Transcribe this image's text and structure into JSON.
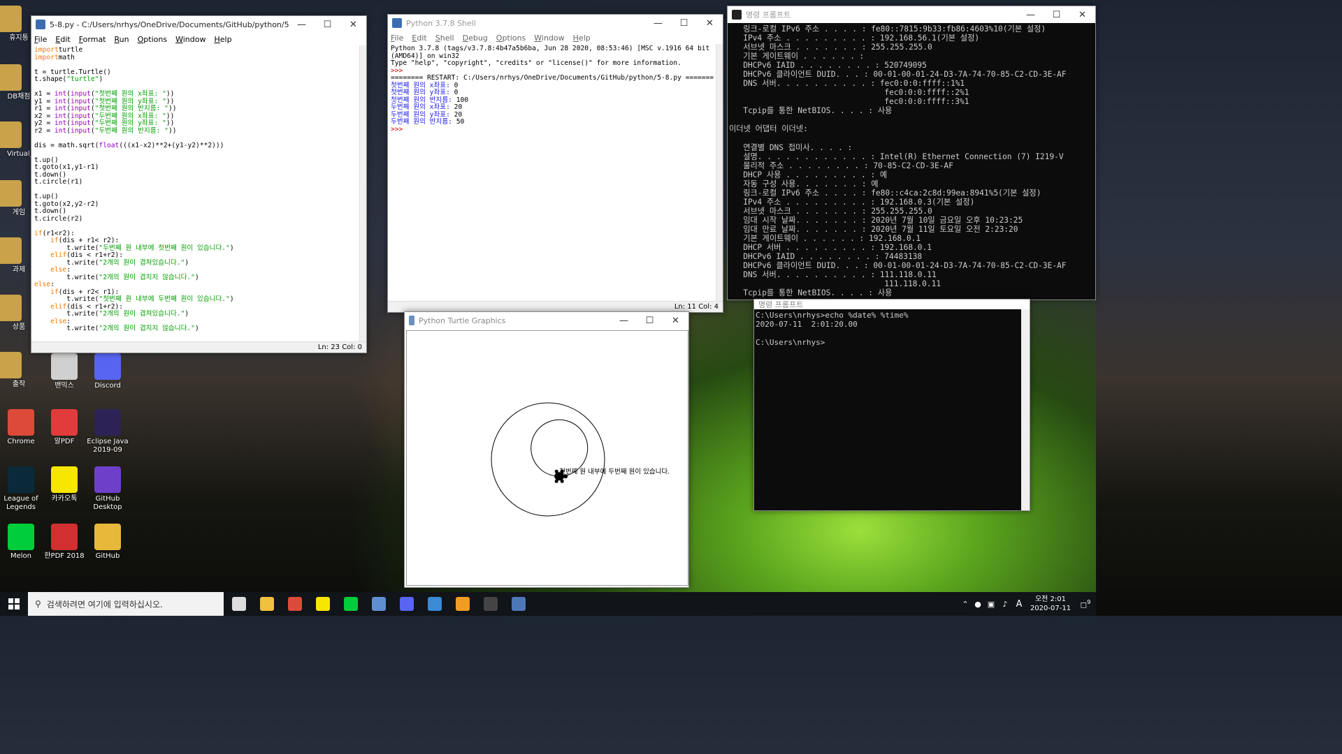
{
  "desktop": {
    "left_labels": [
      "휴지통",
      "DB채점",
      "Virtual_M",
      "게임",
      "과제",
      "상품",
      "출작"
    ],
    "icons": [
      {
        "label": "밴믹스",
        "color": "#d0d0d0"
      },
      {
        "label": "Discord",
        "color": "#5865f2"
      },
      {
        "label": "Chrome",
        "color": "#dd4a3a"
      },
      {
        "label": "알PDF",
        "color": "#e23b3b"
      },
      {
        "label": "Eclipse Java 2019-09",
        "color": "#2c2255"
      },
      {
        "label": "League of Legends",
        "color": "#0a2a3a"
      },
      {
        "label": "카카오톡",
        "color": "#f7e600"
      },
      {
        "label": "GitHub Desktop",
        "color": "#6e40c9"
      },
      {
        "label": "Melon",
        "color": "#00cd3c"
      },
      {
        "label": "한PDF 2018",
        "color": "#d23030"
      },
      {
        "label": "GitHub",
        "color": "#e8b83a"
      }
    ]
  },
  "editor": {
    "title": "5-8.py - C:/Users/nrhys/OneDrive/Documents/GitHub/python/5-8.py (3.7.8)",
    "menu": [
      "File",
      "Edit",
      "Format",
      "Run",
      "Options",
      "Window",
      "Help"
    ],
    "status": "Ln: 23   Col: 0",
    "lines": [
      [
        [
          "kw",
          "import"
        ],
        [
          "",
          "turtle"
        ]
      ],
      [
        [
          "kw",
          "import"
        ],
        [
          "",
          "math"
        ]
      ],
      [
        [
          "",
          ""
        ]
      ],
      [
        [
          "",
          "t = turtle.Turtle()"
        ]
      ],
      [
        [
          "",
          "t.shape("
        ],
        [
          "str",
          "\"turtle\""
        ],
        [
          "",
          ")"
        ]
      ],
      [
        [
          "",
          ""
        ]
      ],
      [
        [
          "",
          "x1 = "
        ],
        [
          "bi",
          "int"
        ],
        [
          "",
          "("
        ],
        [
          "bi",
          "input"
        ],
        [
          "",
          "("
        ],
        [
          "str",
          "\"첫번째 원의 x좌표: \""
        ],
        [
          "",
          "))"
        ]
      ],
      [
        [
          "",
          "y1 = "
        ],
        [
          "bi",
          "int"
        ],
        [
          "",
          "("
        ],
        [
          "bi",
          "input"
        ],
        [
          "",
          "("
        ],
        [
          "str",
          "\"첫번째 원의 y좌표: \""
        ],
        [
          "",
          "))"
        ]
      ],
      [
        [
          "",
          "r1 = "
        ],
        [
          "bi",
          "int"
        ],
        [
          "",
          "("
        ],
        [
          "bi",
          "input"
        ],
        [
          "",
          "("
        ],
        [
          "str",
          "\"첫번째 원의 반지름: \""
        ],
        [
          "",
          "))"
        ]
      ],
      [
        [
          "",
          "x2 = "
        ],
        [
          "bi",
          "int"
        ],
        [
          "",
          "("
        ],
        [
          "bi",
          "input"
        ],
        [
          "",
          "("
        ],
        [
          "str",
          "\"두번째 원의 x좌표: \""
        ],
        [
          "",
          "))"
        ]
      ],
      [
        [
          "",
          "y2 = "
        ],
        [
          "bi",
          "int"
        ],
        [
          "",
          "("
        ],
        [
          "bi",
          "input"
        ],
        [
          "",
          "("
        ],
        [
          "str",
          "\"두번째 원의 y좌표: \""
        ],
        [
          "",
          "))"
        ]
      ],
      [
        [
          "",
          "r2 = "
        ],
        [
          "bi",
          "int"
        ],
        [
          "",
          "("
        ],
        [
          "bi",
          "input"
        ],
        [
          "",
          "("
        ],
        [
          "str",
          "\"두번째 원의 반지름: \""
        ],
        [
          "",
          "))"
        ]
      ],
      [
        [
          "",
          ""
        ]
      ],
      [
        [
          "",
          "dis = math.sqrt("
        ],
        [
          "bi",
          "float"
        ],
        [
          "",
          "(((x1-x2)**2+(y1-y2)**2)))"
        ]
      ],
      [
        [
          "",
          ""
        ]
      ],
      [
        [
          "",
          "t.up()"
        ]
      ],
      [
        [
          "",
          "t.goto(x1,y1-r1)"
        ]
      ],
      [
        [
          "",
          "t.down()"
        ]
      ],
      [
        [
          "",
          "t.circle(r1)"
        ]
      ],
      [
        [
          "",
          ""
        ]
      ],
      [
        [
          "",
          "t.up()"
        ]
      ],
      [
        [
          "",
          "t.goto(x2,y2-r2)"
        ]
      ],
      [
        [
          "",
          "t.down()"
        ]
      ],
      [
        [
          "",
          "t.circle(r2)"
        ]
      ],
      [
        [
          "",
          ""
        ]
      ],
      [
        [
          "kw",
          "if"
        ],
        [
          "",
          "(r1<r2):"
        ]
      ],
      [
        [
          "",
          "    "
        ],
        [
          "kw",
          "if"
        ],
        [
          "",
          "(dis + r1< r2):"
        ]
      ],
      [
        [
          "",
          "        t.write("
        ],
        [
          "str",
          "\"두번째 원 내부에 첫번째 원이 있습니다.\""
        ],
        [
          "",
          ")"
        ]
      ],
      [
        [
          "",
          "    "
        ],
        [
          "kw",
          "elif"
        ],
        [
          "",
          "(dis < r1+r2):"
        ]
      ],
      [
        [
          "",
          "        t.write("
        ],
        [
          "str",
          "\"2개의 원이 겹쳐있습니다.\""
        ],
        [
          "",
          ")"
        ]
      ],
      [
        [
          "",
          "    "
        ],
        [
          "kw",
          "else"
        ],
        [
          "",
          ":"
        ]
      ],
      [
        [
          "",
          "        t.write("
        ],
        [
          "str",
          "\"2개의 원이 겹치지 않습니다.\""
        ],
        [
          "",
          ")"
        ]
      ],
      [
        [
          "kw",
          "else"
        ],
        [
          "",
          ":"
        ]
      ],
      [
        [
          "",
          "    "
        ],
        [
          "kw",
          "if"
        ],
        [
          "",
          "(dis + r2< r1):"
        ]
      ],
      [
        [
          "",
          "        t.write("
        ],
        [
          "str",
          "\"첫번째 원 내부에 두번째 원이 있습니다.\""
        ],
        [
          "",
          ")"
        ]
      ],
      [
        [
          "",
          "    "
        ],
        [
          "kw",
          "elif"
        ],
        [
          "",
          "(dis < r1+r2):"
        ]
      ],
      [
        [
          "",
          "        t.write("
        ],
        [
          "str",
          "\"2개의 원이 겹쳐있습니다.\""
        ],
        [
          "",
          ")"
        ]
      ],
      [
        [
          "",
          "    "
        ],
        [
          "kw",
          "else"
        ],
        [
          "",
          ":"
        ]
      ],
      [
        [
          "",
          "        t.write("
        ],
        [
          "str",
          "\"2개의 원이 겹치지 않습니다.\""
        ],
        [
          "",
          ")"
        ]
      ]
    ]
  },
  "shell": {
    "title": "Python 3.7.8 Shell",
    "menu": [
      "File",
      "Edit",
      "Shell",
      "Debug",
      "Options",
      "Window",
      "Help"
    ],
    "status": "Ln: 11   Col: 4",
    "lines": [
      [
        [
          "",
          "Python 3.7.8 (tags/v3.7.8:4b47a5b6ba, Jun 28 2020, 08:53:46) [MSC v.1916 64 bit"
        ]
      ],
      [
        [
          "",
          "(AMD64)] on win32"
        ]
      ],
      [
        [
          "",
          "Type \"help\", \"copyright\", \"credits\" or \"license()\" for more information."
        ]
      ],
      [
        [
          "red",
          ">>> "
        ]
      ],
      [
        [
          "",
          "======== RESTART: C:/Users/nrhys/OneDrive/Documents/GitHub/python/5-8.py ======="
        ]
      ],
      [
        [
          "blue",
          "첫번째 원의 x좌표: "
        ],
        [
          "",
          "0"
        ]
      ],
      [
        [
          "blue",
          "첫번째 원의 y좌표: "
        ],
        [
          "",
          "0"
        ]
      ],
      [
        [
          "blue",
          "첫번째 원의 반지름: "
        ],
        [
          "",
          "100"
        ]
      ],
      [
        [
          "blue",
          "두번째 원의 x좌표: "
        ],
        [
          "",
          "20"
        ]
      ],
      [
        [
          "blue",
          "두번째 원의 y좌표: "
        ],
        [
          "",
          "20"
        ]
      ],
      [
        [
          "blue",
          "두번째 원의 반지름: "
        ],
        [
          "",
          "50"
        ]
      ],
      [
        [
          "red",
          ">>> "
        ]
      ]
    ]
  },
  "ipconfig": {
    "title": "명령 프롬프트",
    "lines": [
      "   링크-로컬 IPv6 주소 . . . . : fe80::7815:9b33:fb86:4603%10(기본 설정)",
      "   IPv4 주소 . . . . . . . . . : 192.168.56.1(기본 설정)",
      "   서브넷 마스크 . . . . . . . : 255.255.255.0",
      "   기본 게이트웨이 . . . . . . :",
      "   DHCPv6 IAID . . . . . . . . : 520749095",
      "   DHCPv6 클라이언트 DUID. . . : 00-01-00-01-24-D3-7A-74-70-85-C2-CD-3E-AF",
      "   DNS 서버. . . . . . . . . . : fec0:0:0:ffff::1%1",
      "                                 fec0:0:0:ffff::2%1",
      "                                 fec0:0:0:ffff::3%1",
      "   Tcpip를 통한 NetBIOS. . . . : 사용",
      "",
      "이더넷 어댑터 이더넷:",
      "",
      "   연결별 DNS 접미사. . . . :",
      "   설명. . . . . . . . . . . . : Intel(R) Ethernet Connection (7) I219-V",
      "   물리적 주소 . . . . . . . . : 70-85-C2-CD-3E-AF",
      "   DHCP 사용 . . . . . . . . . : 예",
      "   자동 구성 사용. . . . . . . : 예",
      "   링크-로컬 IPv6 주소 . . . . : fe80::c4ca:2c8d:99ea:8941%5(기본 설정)",
      "   IPv4 주소 . . . . . . . . . : 192.168.0.3(기본 설정)",
      "   서브넷 마스크 . . . . . . . : 255.255.255.0",
      "   임대 시작 날짜. . . . . . . : 2020년 7월 10일 금요일 오후 10:23:25",
      "   임대 만료 날짜. . . . . . . : 2020년 7월 11일 토요일 오전 2:23:20",
      "   기본 게이트웨이 . . . . . . : 192.168.0.1",
      "   DHCP 서버 . . . . . . . . . : 192.168.0.1",
      "   DHCPv6 IAID . . . . . . . . : 74483138",
      "   DHCPv6 클라이언트 DUID. . . : 00-01-00-01-24-D3-7A-74-70-85-C2-CD-3E-AF",
      "   DNS 서버. . . . . . . . . . : 111.118.0.11",
      "                                 111.118.0.11",
      "   Tcpip를 통한 NetBIOS. . . . : 사용"
    ]
  },
  "cmd2": {
    "title": "명령 프롬프트",
    "lines": [
      "C:\\Users\\nrhys>echo %date% %time%",
      "2020-07-11  2:01:20.00",
      "",
      "C:\\Users\\nrhys>"
    ]
  },
  "turtle": {
    "title": "Python Turtle Graphics",
    "message": "첫번째 원 내부에 두번째 원이 있습니다.",
    "circle1": {
      "x": 0,
      "y": 0,
      "r": 100
    },
    "circle2": {
      "x": 20,
      "y": 20,
      "r": 50
    }
  },
  "taskbar": {
    "search_placeholder": "검색하려면 여기에 입력하십시오.",
    "time": "오전 2:01",
    "date": "2020-07-11",
    "ime": "A",
    "notif_count": "9",
    "apps": [
      {
        "name": "task-view",
        "color": "#dddddd"
      },
      {
        "name": "file-explorer",
        "color": "#f0c040"
      },
      {
        "name": "chrome",
        "color": "#dd4a3a"
      },
      {
        "name": "kakaotalk",
        "color": "#f7e600"
      },
      {
        "name": "melon",
        "color": "#00cd3c"
      },
      {
        "name": "virtualbox",
        "color": "#5f8fd0"
      },
      {
        "name": "discord",
        "color": "#5865f2"
      },
      {
        "name": "app-blue",
        "color": "#3a8ad6"
      },
      {
        "name": "sublime",
        "color": "#f39c25"
      },
      {
        "name": "terminal",
        "color": "#444444"
      },
      {
        "name": "python-idle",
        "color": "#4d78b8"
      }
    ]
  }
}
